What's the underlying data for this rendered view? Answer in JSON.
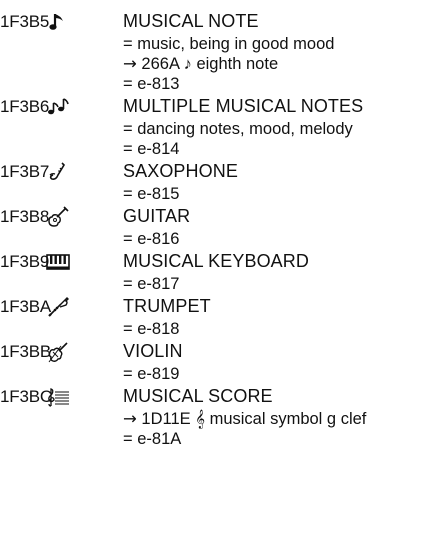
{
  "entries": [
    {
      "code": "1F3B5",
      "glyph": "♪",
      "icon": "musical-note-icon",
      "name": "MUSICAL NOTE",
      "lines": [
        {
          "prefix": "=",
          "text": "music, being in good mood"
        },
        {
          "prefix": "→",
          "text": "266A ♪ eighth note"
        },
        {
          "prefix": "=",
          "text": "e-813"
        }
      ]
    },
    {
      "code": "1F3B6",
      "glyph": "♫",
      "icon": "multiple-musical-notes-icon",
      "name": "MULTIPLE MUSICAL NOTES",
      "lines": [
        {
          "prefix": "=",
          "text": "dancing notes, mood, melody"
        },
        {
          "prefix": "=",
          "text": "e-814"
        }
      ]
    },
    {
      "code": "1F3B7",
      "glyph": "",
      "icon": "saxophone-icon",
      "name": "SAXOPHONE",
      "lines": [
        {
          "prefix": "=",
          "text": "e-815"
        }
      ]
    },
    {
      "code": "1F3B8",
      "glyph": "",
      "icon": "guitar-icon",
      "name": "GUITAR",
      "lines": [
        {
          "prefix": "=",
          "text": "e-816"
        }
      ]
    },
    {
      "code": "1F3B9",
      "glyph": "",
      "icon": "musical-keyboard-icon",
      "name": "MUSICAL KEYBOARD",
      "lines": [
        {
          "prefix": "=",
          "text": "e-817"
        }
      ]
    },
    {
      "code": "1F3BA",
      "glyph": "",
      "icon": "trumpet-icon",
      "name": "TRUMPET",
      "lines": [
        {
          "prefix": "=",
          "text": "e-818"
        }
      ]
    },
    {
      "code": "1F3BB",
      "glyph": "",
      "icon": "violin-icon",
      "name": "VIOLIN",
      "lines": [
        {
          "prefix": "=",
          "text": "e-819"
        }
      ]
    },
    {
      "code": "1F3BC",
      "glyph": "",
      "icon": "musical-score-icon",
      "name": "MUSICAL SCORE",
      "lines": [
        {
          "prefix": "→",
          "text": "1D11E 𝄞 musical symbol g clef"
        },
        {
          "prefix": "=",
          "text": "e-81A"
        }
      ]
    }
  ]
}
